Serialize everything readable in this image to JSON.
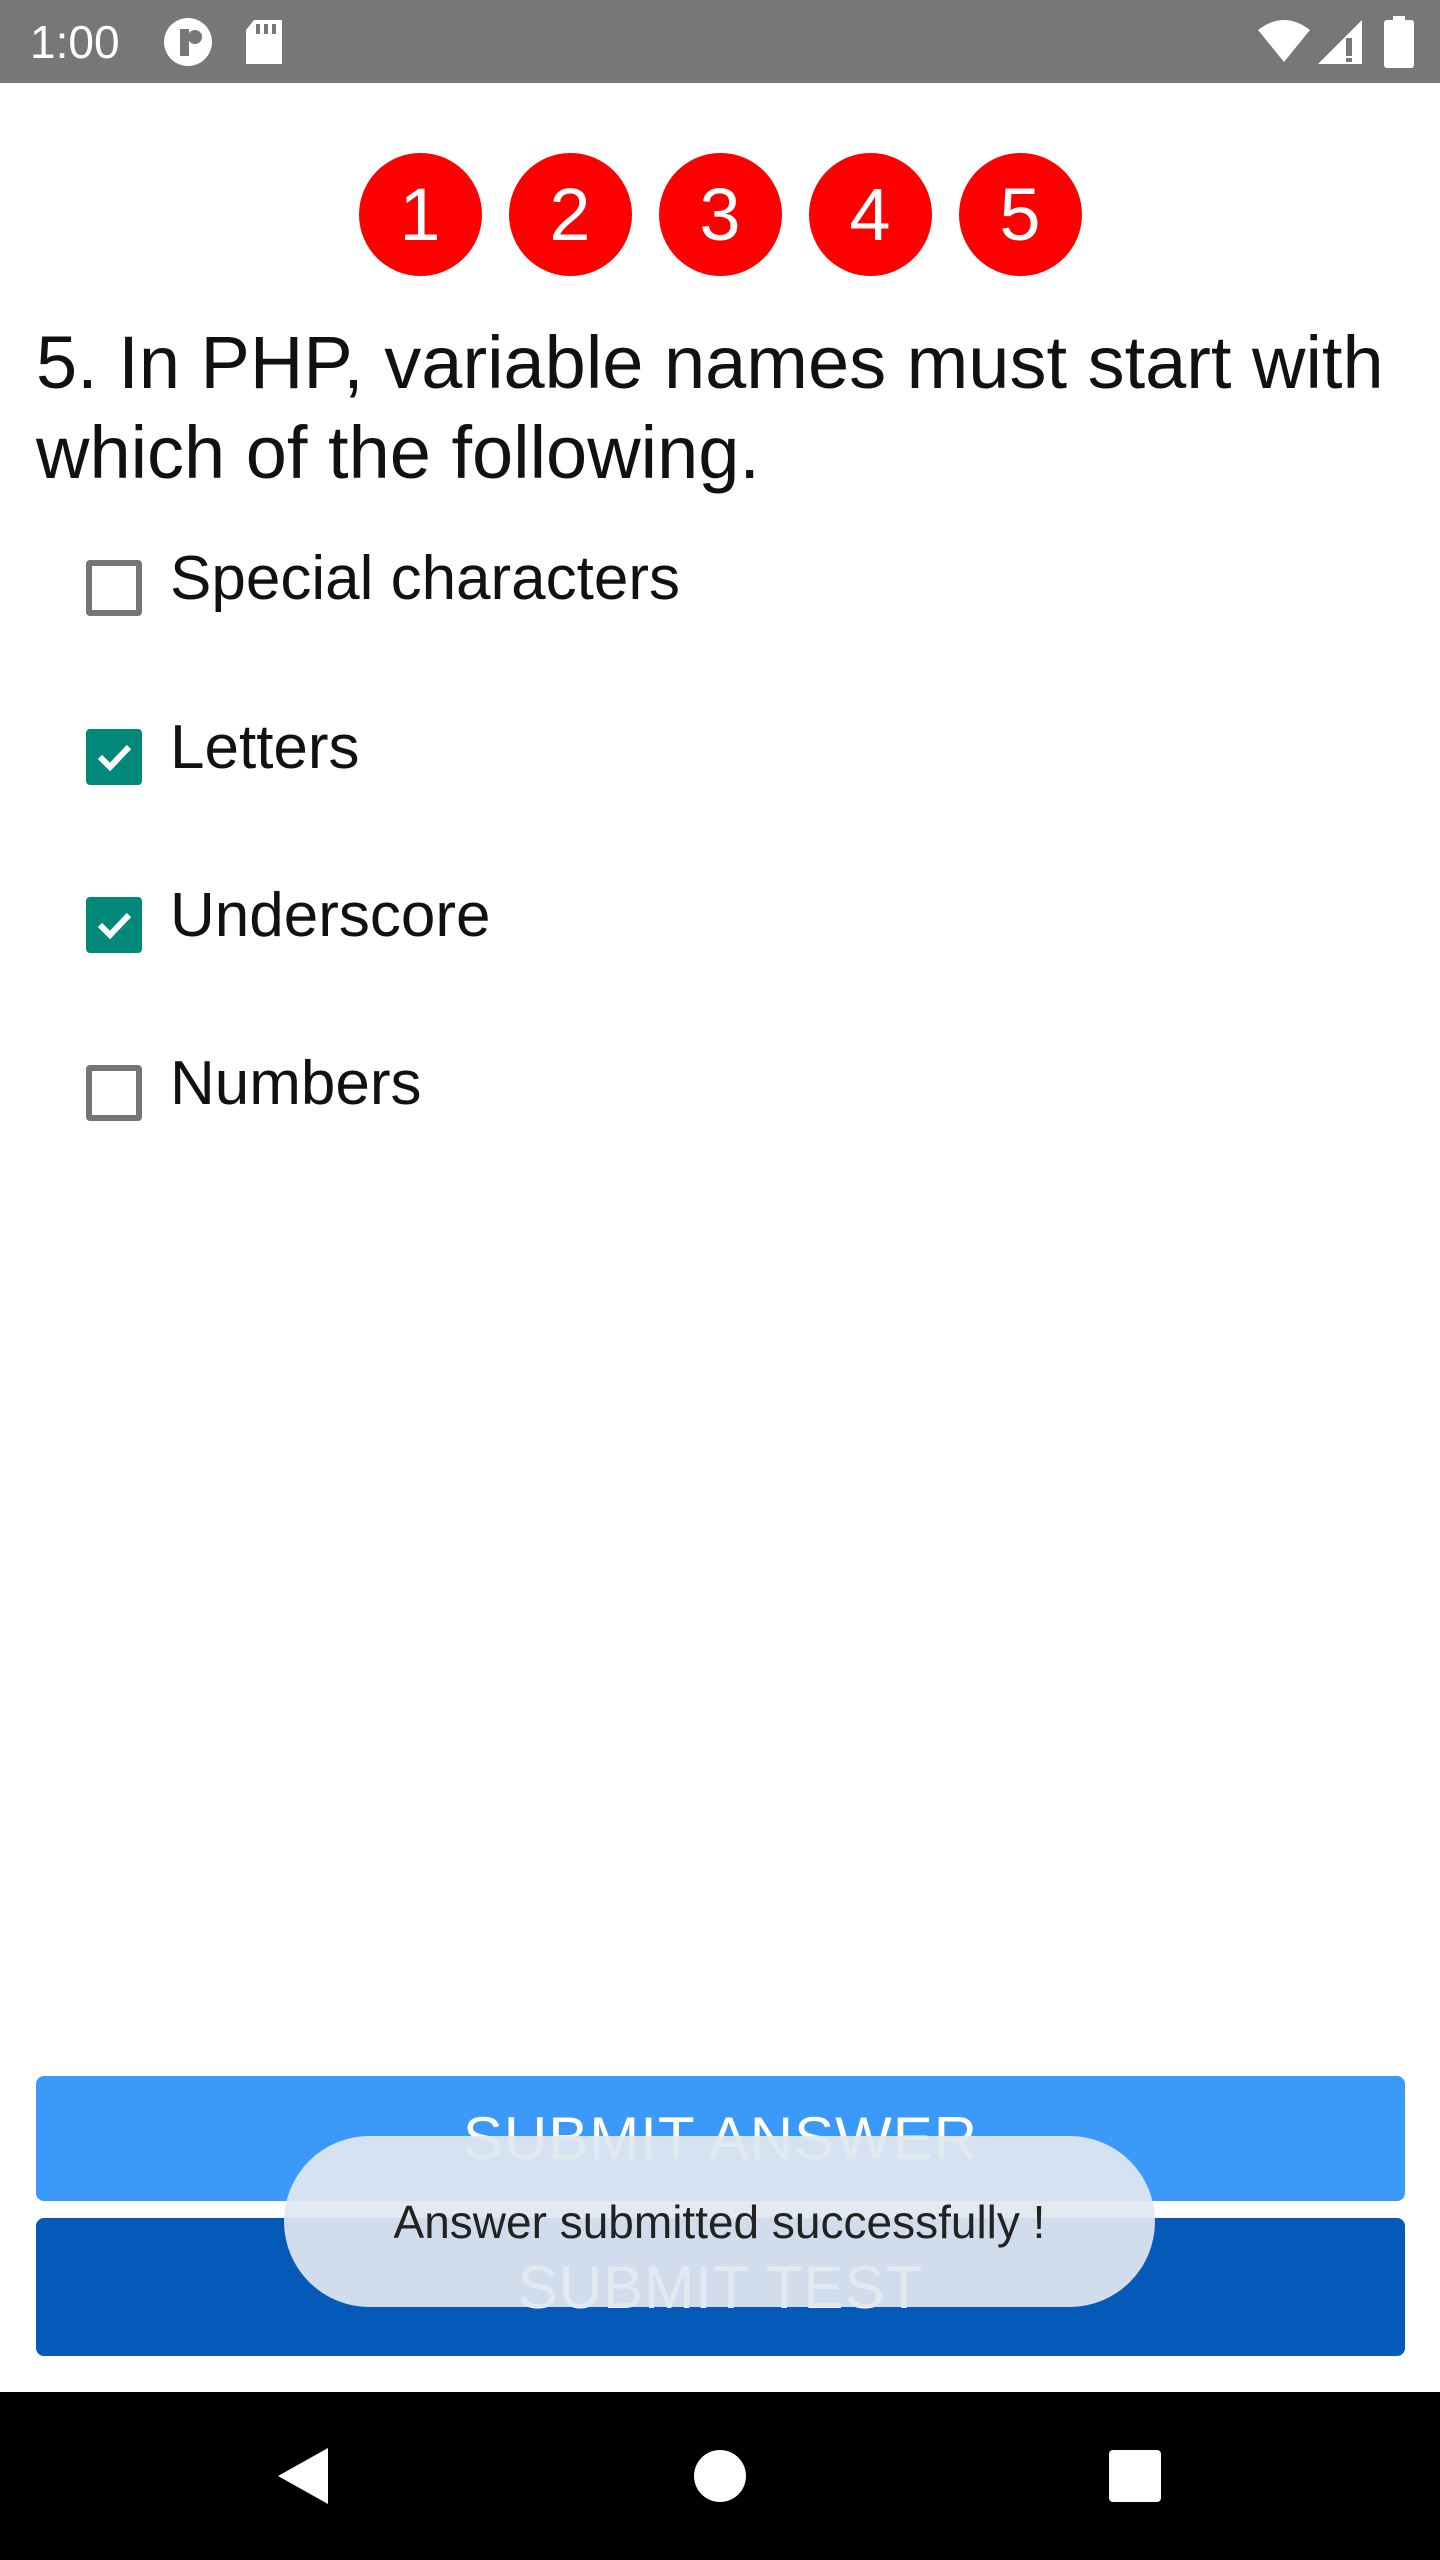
{
  "status_bar": {
    "time": "1:00",
    "left_icons": [
      "notification-circle-icon",
      "sd-card-icon"
    ],
    "right_icons": [
      "wifi-icon",
      "cell-signal-icon",
      "battery-icon"
    ]
  },
  "question_nav": {
    "items": [
      "1",
      "2",
      "3",
      "4",
      "5"
    ],
    "color": "#ff0000"
  },
  "question": {
    "text": "5. In PHP, variable names must start with which of the following."
  },
  "options": [
    {
      "label": "Special characters",
      "checked": false
    },
    {
      "label": "Letters",
      "checked": true
    },
    {
      "label": "Underscore",
      "checked": true
    },
    {
      "label": "Numbers",
      "checked": false
    }
  ],
  "buttons": {
    "submit_answer": "SUBMIT ANSWER",
    "submit_test": "SUBMIT TEST"
  },
  "toast": {
    "message": "Answer submitted successfully !"
  },
  "nav_bar": {
    "icons": [
      "back-icon",
      "home-icon",
      "recents-icon"
    ]
  },
  "colors": {
    "accent_check": "#00897b",
    "submit_answer_bg": "#3b99f9",
    "submit_test_bg": "#0459b9"
  }
}
